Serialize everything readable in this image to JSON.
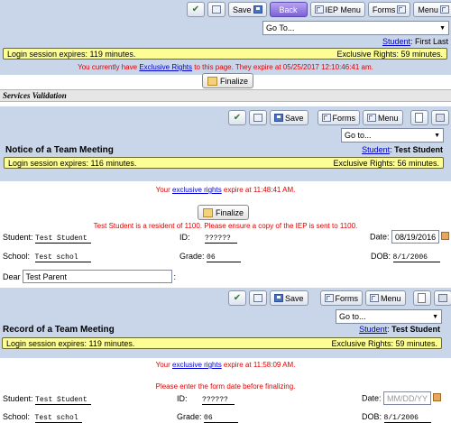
{
  "top": {
    "buttons": {
      "save": "Save",
      "back": "Back",
      "iep_menu": "IEP Menu",
      "forms": "Forms",
      "menu": "Menu"
    },
    "goto": "Go To...",
    "student_label": "Student",
    "student_value": "First Last",
    "session": "Login session expires: 119 minutes.",
    "exclusive": "Exclusive Rights: 59 minutes.",
    "rights_pre": "You currently have ",
    "rights_link": "Exclusive Rights",
    "rights_post": " to this page. They expire at 05/25/2017 12:10:46:41 am.",
    "finalize": "Finalize",
    "section": "Services Validation"
  },
  "notice": {
    "buttons": {
      "save": "Save",
      "forms": "Forms",
      "menu": "Menu"
    },
    "goto": "Go to...",
    "title": "Notice of a Team Meeting",
    "student_label": "Student",
    "student_value": "Test Student",
    "session": "Login session expires: 116 minutes.",
    "exclusive": "Exclusive Rights: 56 minutes.",
    "rights_pre": "Your ",
    "rights_link": "exclusive rights",
    "rights_post": " expire at 11:48:41 AM.",
    "finalize": "Finalize",
    "resident_msg": "Test Student is a resident of 1100. Please ensure a copy of the IEP is sent to 1100.",
    "fields": {
      "student_lbl": "Student:",
      "student_val": "Test Student",
      "id_lbl": "ID:",
      "id_val": "??????",
      "date_lbl": "Date:",
      "date_val": "08/19/2016",
      "school_lbl": "School:",
      "school_val": "Test schol",
      "grade_lbl": "Grade:",
      "grade_val": "06",
      "dob_lbl": "DOB:",
      "dob_val": "8/1/2006"
    },
    "dear_lbl": "Dear",
    "dear_val": "Test Parent",
    "dear_suffix": ":"
  },
  "record": {
    "buttons": {
      "save": "Save",
      "forms": "Forms",
      "menu": "Menu"
    },
    "goto": "Go to...",
    "title": "Record of a Team Meeting",
    "student_label": "Student",
    "student_value": "Test Student",
    "session": "Login session expires: 119 minutes.",
    "exclusive": "Exclusive Rights: 59 minutes.",
    "rights_pre": "Your ",
    "rights_link": "exclusive rights",
    "rights_post": " expire at 11:58:09 AM.",
    "form_date_msg": "Please enter the form date before finalizing.",
    "fields": {
      "student_lbl": "Student:",
      "student_val": "Test Student",
      "id_lbl": "ID:",
      "id_val": "??????",
      "date_lbl": "Date:",
      "date_placeholder": "MM/DD/YY",
      "school_lbl": "School:",
      "school_val": "Test schol",
      "grade_lbl": "Grade:",
      "grade_val": "06",
      "dob_lbl": "DOB:",
      "dob_val": "8/1/2006"
    }
  }
}
